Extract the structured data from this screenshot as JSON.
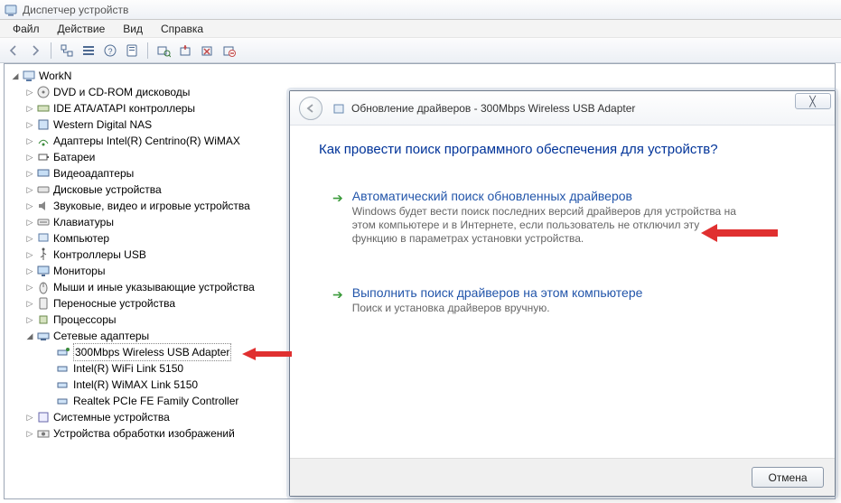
{
  "window": {
    "title": "Диспетчер устройств"
  },
  "menu": {
    "file": "Файл",
    "action": "Действие",
    "view": "Вид",
    "help": "Справка"
  },
  "tree": {
    "root": "WorkN",
    "items": [
      "DVD и CD-ROM дисководы",
      "IDE ATA/ATAPI контроллеры",
      "Western Digital NAS",
      "Адаптеры Intel(R) Centrino(R) WiMAX",
      "Батареи",
      "Видеоадаптеры",
      "Дисковые устройства",
      "Звуковые, видео и игровые устройства",
      "Клавиатуры",
      "Компьютер",
      "Контроллеры USB",
      "Мониторы",
      "Мыши и иные указывающие устройства",
      "Переносные устройства",
      "Процессоры"
    ],
    "network_label": "Сетевые адаптеры",
    "network_children": [
      "300Mbps Wireless USB Adapter",
      "Intel(R) WiFi Link 5150",
      "Intel(R) WiMAX Link 5150",
      "Realtek PCIe FE Family Controller"
    ],
    "after_network": [
      "Системные устройства",
      "Устройства обработки изображений"
    ]
  },
  "dialog": {
    "title": "Обновление драйверов - 300Mbps Wireless USB Adapter",
    "question": "Как провести поиск программного обеспечения для устройств?",
    "opt1_title": "Автоматический поиск обновленных драйверов",
    "opt1_desc": "Windows будет вести поиск последних версий драйверов для устройства на этом компьютере и в Интернете, если пользователь не отключил эту функцию в параметрах установки устройства.",
    "opt2_title": "Выполнить поиск драйверов на этом компьютере",
    "opt2_desc": "Поиск и установка драйверов вручную.",
    "cancel": "Отмена"
  }
}
